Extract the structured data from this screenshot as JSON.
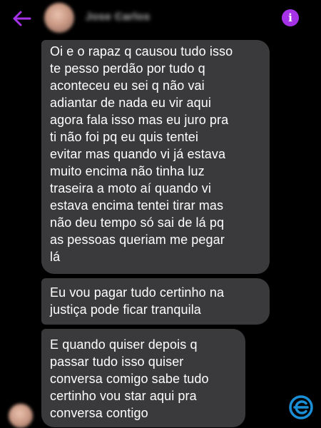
{
  "header": {
    "contact_name": "Jose Carlos",
    "icons": {
      "back": "arrow-left-icon",
      "info": "info-icon"
    },
    "accent_color": "#a632e8"
  },
  "messages": [
    {
      "text": "Oi e o rapaz q causou tudo isso\nte pesso perdão por tudo q\naconteceu eu sei q não vai\nadiantar de nada eu vir aqui\nagora fala isso mas eu juro pra\nti não foi pq eu quis tentei\nevitar mas quando vi já estava\nmuito encima não tinha luz\ntraseira a moto aí quando vi\nestava encima tentei tirar mas\nnão deu tempo só sai de lá pq\nas pessoas queriam me pegar\nlá"
    },
    {
      "text": "Eu vou pagar tudo certinho na\njustiça  pode ficar tranquila"
    },
    {
      "text": "E quando quiser depois q\npassar tudo isso quiser\nconversa comigo sabe tudo\ncertinho vou star aqui pra\nconversa contigo"
    }
  ],
  "colors": {
    "background": "#000000",
    "bubble": "#3a3a3c",
    "text": "#ffffff",
    "watermark": "#1a8fd6"
  }
}
